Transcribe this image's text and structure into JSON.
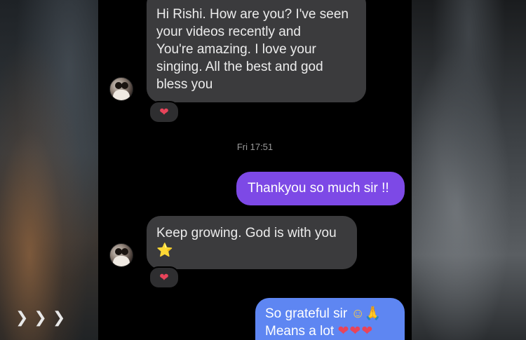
{
  "messages": {
    "m1": {
      "lines": [
        "Hi Rishi. How are you? I've seen",
        "your videos recently and",
        "You're amazing. I love your",
        "singing. All the best and god",
        "bless you"
      ],
      "reaction": "❤"
    },
    "timestamp": "Fri 17:51",
    "m2": {
      "text": "Thankyou so much sir !!"
    },
    "m3": {
      "line1": "Keep growing. God is with you",
      "emoji": "⭐",
      "reaction": "❤"
    },
    "m4": {
      "line1": "So grateful sir",
      "line1_emoji": "☺🙏",
      "line2": "Means a lot",
      "line2_emoji": "❤❤❤"
    }
  },
  "decor": {
    "chevrons": "❯❯❯"
  },
  "colors": {
    "incoming": "#3b3b3d",
    "outgoing_purple": "#7d49e6",
    "outgoing_blue": "#5e86f2",
    "heart": "#e8445a"
  }
}
